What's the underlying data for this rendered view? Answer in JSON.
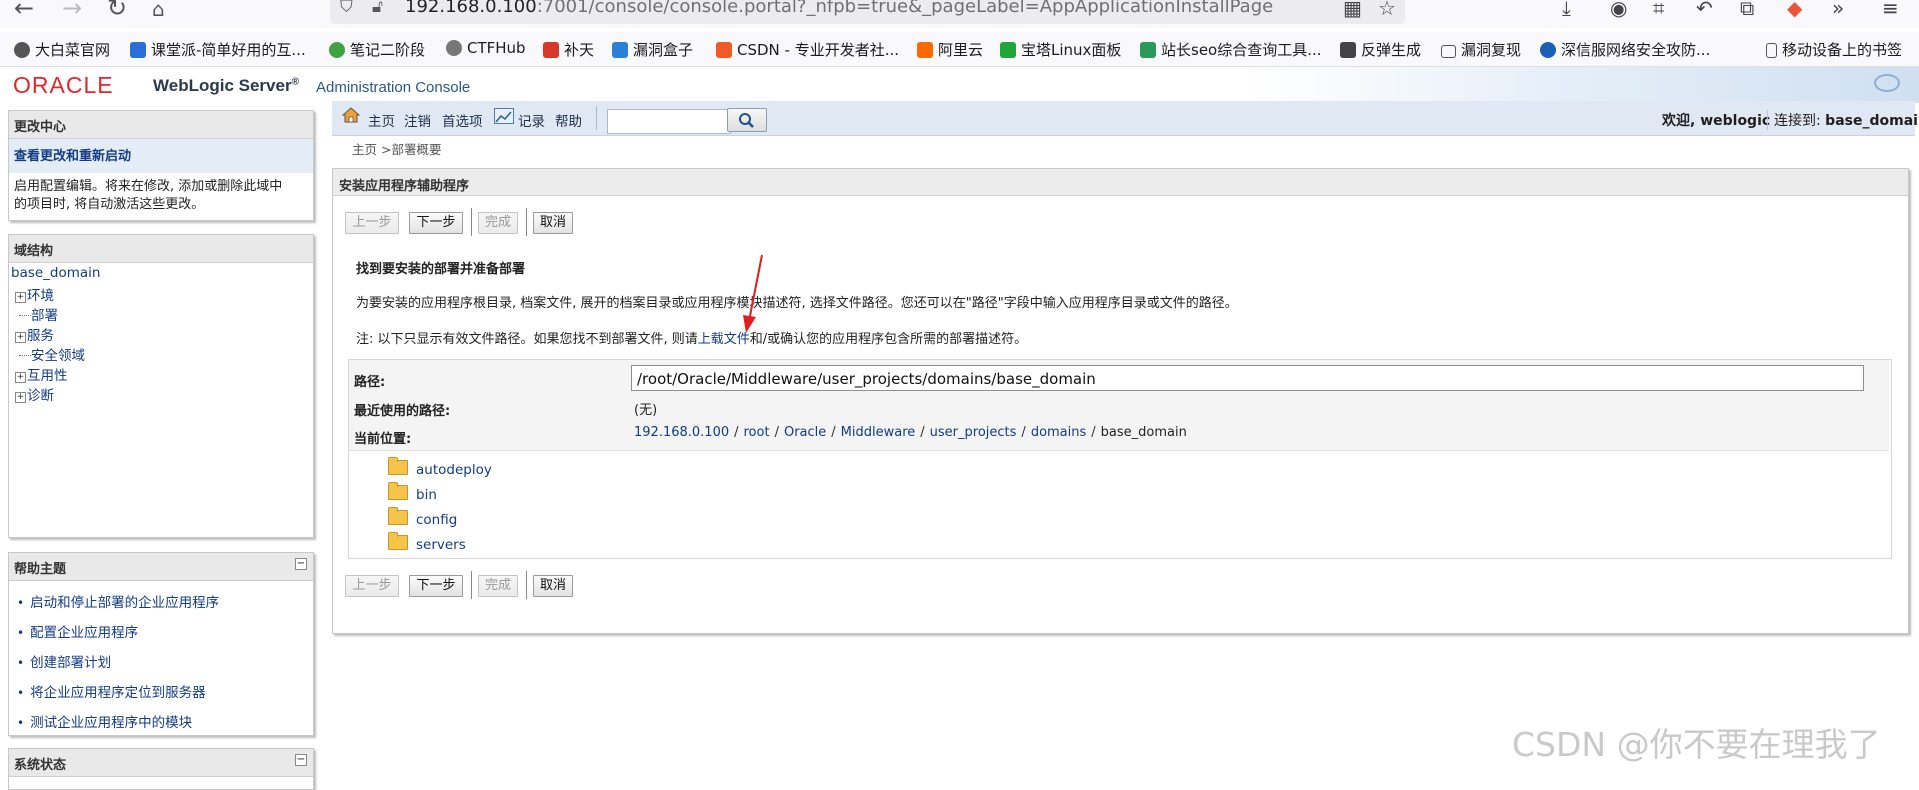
{
  "browser": {
    "url_host": "192.168.0.100",
    "url_rest": ":7001/console/console.portal?_nfpb=true&_pageLabel=AppApplicationInstallPage",
    "bookmarks": [
      "大白菜官网",
      "课堂派-简单好用的互...",
      "笔记二阶段",
      "CTFHub",
      "补天",
      "漏洞盒子",
      "CSDN - 专业开发者社...",
      "阿里云",
      "宝塔Linux面板",
      "站长seo综合查询工具...",
      "反弹生成",
      "漏洞复现",
      "深信服网络安全攻防...",
      "移动设备上的书签"
    ]
  },
  "header": {
    "oracle": "ORACLE",
    "product": "WebLogic Server",
    "reg": "®",
    "console": "Administration Console"
  },
  "change_center": {
    "title": "更改中心",
    "link": "查看更改和重新启动",
    "desc_line1": "启用配置编辑。将来在修改, 添加或删除此域中",
    "desc_line2": "的项目时, 将自动激活这些更改。"
  },
  "domain_structure": {
    "title": "域结构",
    "root": "base_domain",
    "nodes": [
      "环境",
      "部署",
      "服务",
      "安全领域",
      "互用性",
      "诊断"
    ]
  },
  "help_topics": {
    "title": "帮助主题",
    "items": [
      "启动和停止部署的企业应用程序",
      "配置企业应用程序",
      "创建部署计划",
      "将企业应用程序定位到服务器",
      "测试企业应用程序中的模块"
    ]
  },
  "system_status": {
    "title": "系统状态"
  },
  "toolbar": {
    "home": "主页",
    "logout": "注销",
    "preferences": "首选项",
    "record": "记录",
    "help": "帮助",
    "search_value": "",
    "welcome": "欢迎, weblogic",
    "connected_label": "连接到:",
    "connected_domain": "base_domain"
  },
  "breadcrumb": "主页 >部署概要",
  "wizard": {
    "title": "安装应用程序辅助程序",
    "buttons": {
      "back": "上一步",
      "next": "下一步",
      "finish": "完成",
      "cancel": "取消"
    },
    "section_title": "找到要安装的部署并准备部署",
    "description": "为要安装的应用程序根目录, 档案文件, 展开的档案目录或应用程序模块描述符, 选择文件路径。您还可以在\"路径\"字段中输入应用程序目录或文件的路径。",
    "note_prefix": "注: 以下只显示有效文件路径。如果您找不到部署文件, 则请",
    "note_link": "上载文件",
    "note_suffix": "和/或确认您的应用程序包含所需的部署描述符。",
    "path_label": "路径:",
    "path_value": "/root/Oracle/Middleware/user_projects/domains/base_domain",
    "recent_label": "最近使用的路径:",
    "recent_value": "(无)",
    "location_label": "当前位置:",
    "location": [
      "192.168.0.100",
      "root",
      "Oracle",
      "Middleware",
      "user_projects",
      "domains"
    ],
    "location_current": "base_domain",
    "directories": [
      "autodeploy",
      "bin",
      "config",
      "servers"
    ]
  },
  "watermark": "CSDN @你不要在理我了",
  "colors": {
    "oracle_red": "#e3262a",
    "link": "#133c84",
    "toolbar_bg": "#dfe8f3",
    "arrow": "#e02020"
  }
}
